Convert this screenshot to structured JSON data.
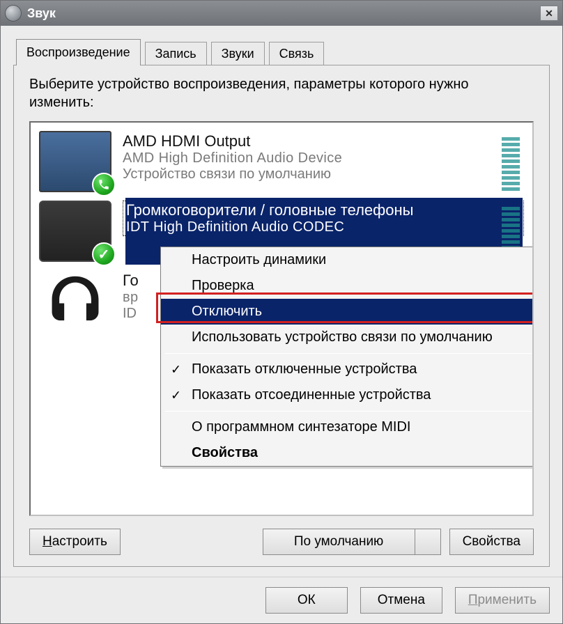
{
  "window": {
    "title": "Звук"
  },
  "tabs": {
    "playback": "Воспроизведение",
    "record": "Запись",
    "sounds": "Звуки",
    "comm": "Связь"
  },
  "instruction": "Выберите устройство воспроизведения, параметры которого нужно изменить:",
  "devices": [
    {
      "title": "AMD HDMI Output",
      "sub": "AMD High Definition Audio Device",
      "status": "Устройство связи по умолчанию",
      "icon": "tv",
      "badge": "phone",
      "selected": false
    },
    {
      "title": "Громкоговорители / головные телефоны",
      "sub": "IDT High Definition Audio CODEC",
      "status": " ",
      "icon": "laptop",
      "badge": "check",
      "selected": true
    },
    {
      "title": "Го",
      "sub": "вр",
      "status": "ID",
      "icon": "headphones",
      "badge": "",
      "selected": false
    }
  ],
  "context_menu": {
    "configure": "Настроить динамики",
    "test": "Проверка",
    "disable": "Отключить",
    "use_comm_default": "Использовать устройство связи по умолчанию",
    "show_disabled": "Показать отключенные устройства",
    "show_disconnected": "Показать отсоединенные устройства",
    "about_midi": "О программном синтезаторе MIDI",
    "properties": "Свойства"
  },
  "panel_buttons": {
    "configure": "Настроить",
    "default": "По умолчанию",
    "properties": "Свойства"
  },
  "dialog_buttons": {
    "ok": "ОК",
    "cancel": "Отмена",
    "apply": "Применить"
  }
}
